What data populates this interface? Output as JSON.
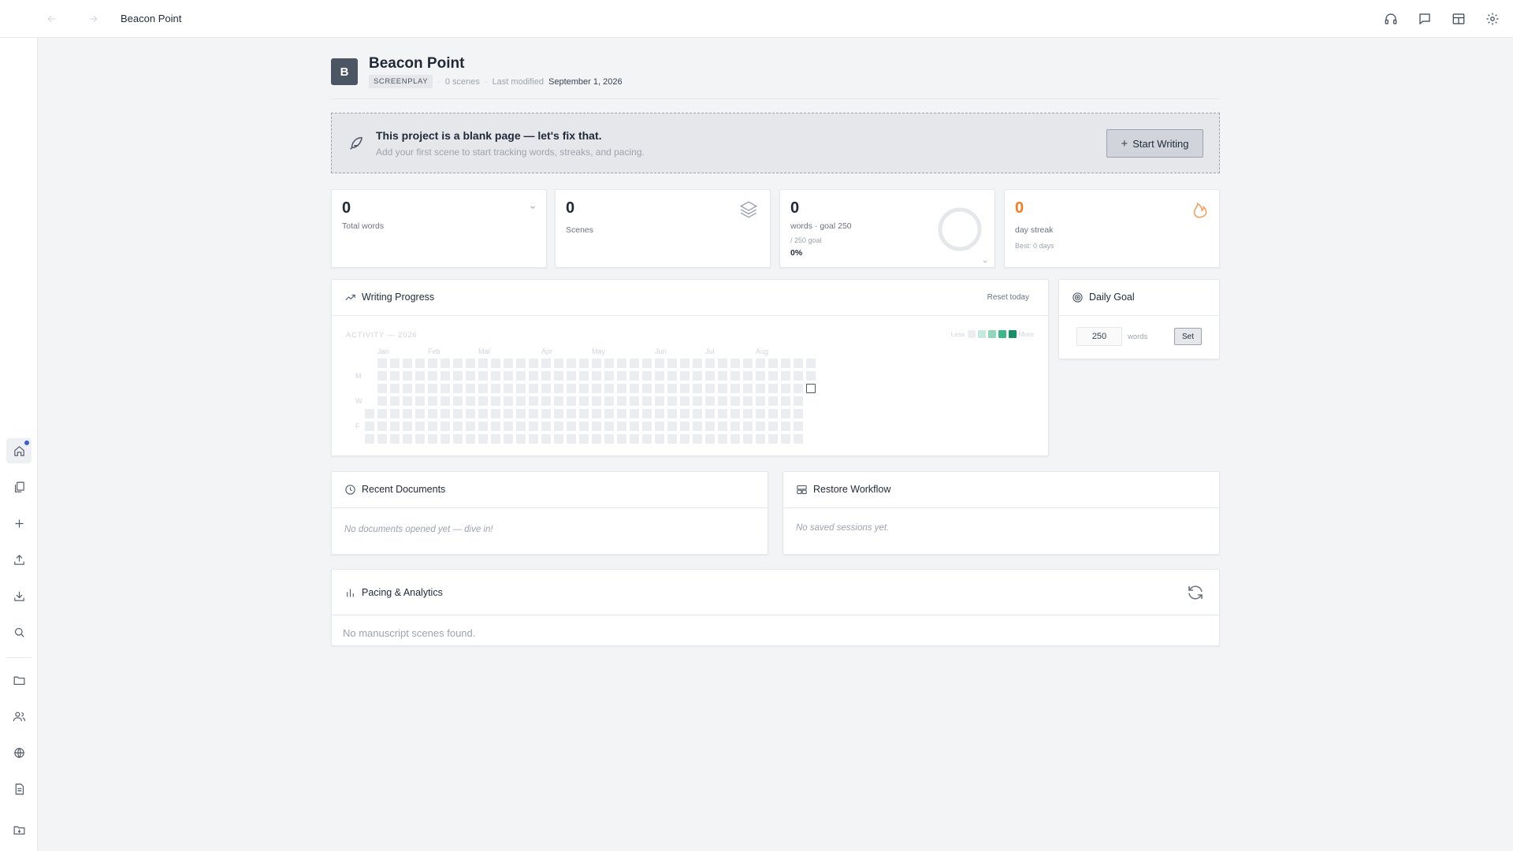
{
  "topbar": {
    "title": "Beacon Point",
    "icons": [
      "headphones-icon",
      "chat-icon",
      "layout-icon",
      "gear-icon"
    ]
  },
  "rail": {
    "items": [
      "home-icon",
      "documents-icon",
      "plus-icon",
      "upload-icon",
      "download-icon",
      "search-icon",
      "folder-icon",
      "users-icon",
      "globe-icon",
      "notes-icon",
      "folder-import-icon"
    ]
  },
  "project": {
    "initial": "B",
    "title": "Beacon Point",
    "type_badge": "SCREENPLAY",
    "scene_count": "0 scenes",
    "modified_label": "Last modified",
    "modified_date": "September 1, 2026"
  },
  "banner": {
    "title": "This project is a blank page — let's fix that.",
    "subtitle": "Add your first scene to start tracking words, streaks, and pacing.",
    "button_label": "Start Writing"
  },
  "stats": {
    "total_words": {
      "value": "0",
      "label": "Total words"
    },
    "scenes": {
      "value": "0",
      "label": "Scenes"
    },
    "goal": {
      "value": "0",
      "label": "words · goal 250",
      "sub": "/ 250 goal",
      "percent": "0%",
      "progress": 0
    },
    "streak": {
      "value": "0",
      "label": "day streak",
      "sub": "Best: 0 days"
    }
  },
  "writing_progress": {
    "title": "Writing Progress",
    "reset_label": "Reset today",
    "activity_label": "ACTIVITY — 2026",
    "legend_less": "Less",
    "legend_more": "More",
    "legend_colors": [
      "#ebedf0",
      "#c6e9dd",
      "#8fd6bd",
      "#3fb58b",
      "#1a8f66"
    ],
    "months": [
      "Jan",
      "Feb",
      "Mar",
      "Apr",
      "May",
      "Jun",
      "Jul",
      "Aug"
    ],
    "day_labels": [
      "M",
      "W",
      "F"
    ],
    "weeks": 36,
    "first_week_start_row": 4,
    "today_week": 35,
    "today_row": 2
  },
  "daily_goal": {
    "title": "Daily Goal",
    "value": "250",
    "unit": "words",
    "set_label": "Set"
  },
  "recent_documents": {
    "title": "Recent Documents",
    "empty": "No documents opened yet — dive in!"
  },
  "restore_workflow": {
    "title": "Restore Workflow",
    "empty": "No saved sessions yet."
  },
  "pacing": {
    "title": "Pacing & Analytics",
    "empty": "No manuscript scenes found."
  }
}
